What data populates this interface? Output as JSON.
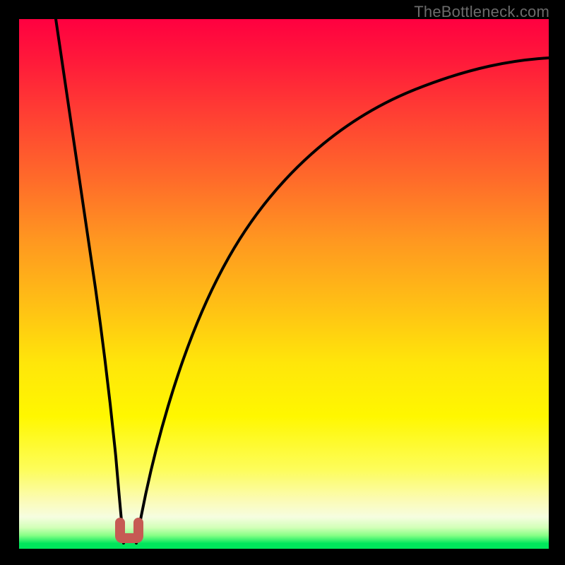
{
  "watermark": "TheBottleneck.com",
  "colors": {
    "curve": "#000000",
    "u_shape": "#c65a54",
    "frame": "#000000"
  },
  "chart_data": {
    "type": "line",
    "title": "",
    "xlabel": "",
    "ylabel": "",
    "xlim": [
      0,
      100
    ],
    "ylim": [
      0,
      100
    ],
    "grid": false,
    "legend": false,
    "series": [
      {
        "name": "left-branch",
        "x": [
          7,
          9,
          11,
          13,
          15,
          17,
          18.5,
          19.5
        ],
        "values": [
          100,
          83,
          66,
          49,
          33,
          16,
          6,
          1
        ]
      },
      {
        "name": "right-branch",
        "x": [
          22,
          24,
          27,
          31,
          36,
          42,
          50,
          60,
          72,
          86,
          100
        ],
        "values": [
          1,
          10,
          22,
          36,
          49,
          59,
          68,
          76,
          82,
          87,
          91
        ]
      }
    ],
    "annotation": {
      "name": "u-marker",
      "x": 20.5,
      "y": 1
    },
    "gradient_scale": {
      "top_color": "#ff0040",
      "bottom_color": "#00e65c",
      "meaning": "high-to-low"
    }
  }
}
